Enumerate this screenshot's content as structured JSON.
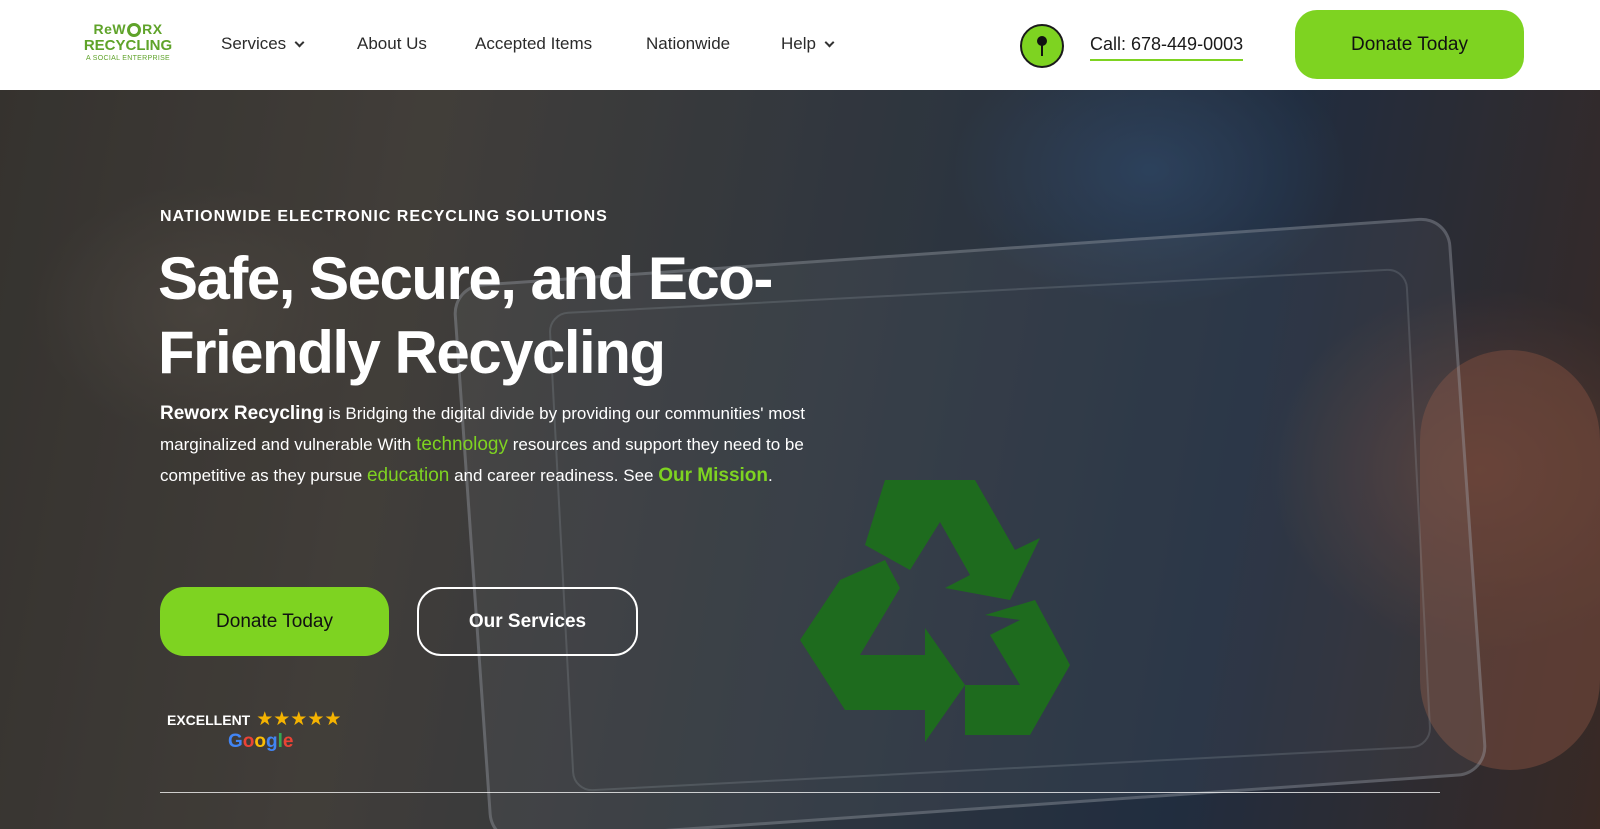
{
  "header": {
    "logo": {
      "line1_a": "ReW",
      "line1_b": "RX",
      "line2": "RECYCLING",
      "line3": "A SOCIAL ENTERPRISE"
    },
    "nav": [
      {
        "label": "Services",
        "has_dropdown": true
      },
      {
        "label": "About Us",
        "has_dropdown": false
      },
      {
        "label": "Accepted Items",
        "has_dropdown": false
      },
      {
        "label": "Nationwide",
        "has_dropdown": false
      },
      {
        "label": "Help",
        "has_dropdown": true
      }
    ],
    "location_icon": "map-pin-icon",
    "call_label": "Call: 678-449-0003",
    "donate_label": "Donate Today"
  },
  "hero": {
    "eyebrow": "NATIONWIDE ELECTRONIC RECYCLING SOLUTIONS",
    "title": "Safe, Secure, and Eco-Friendly Recycling",
    "paragraph": {
      "brand": "Reworx Recycling",
      "part1": " is Bridging the digital divide by providing our communities' most marginalized and vulnerable With ",
      "hl1": "technology",
      "part2": " resources and support they need to be competitive as they pursue ",
      "hl2": "education",
      "part3": " and career readiness. See ",
      "link": "Our Mission",
      "part4": "."
    },
    "donate_label": "Donate Today",
    "services_label": "Our Services",
    "review": {
      "label": "EXCELLENT",
      "stars": "★★★★★",
      "rating": 5,
      "provider": "Google"
    }
  },
  "colors": {
    "accent": "#7ed321",
    "brand_green": "#5fa32a",
    "recycle_green": "#1e6b1e",
    "star": "#f5b301"
  }
}
